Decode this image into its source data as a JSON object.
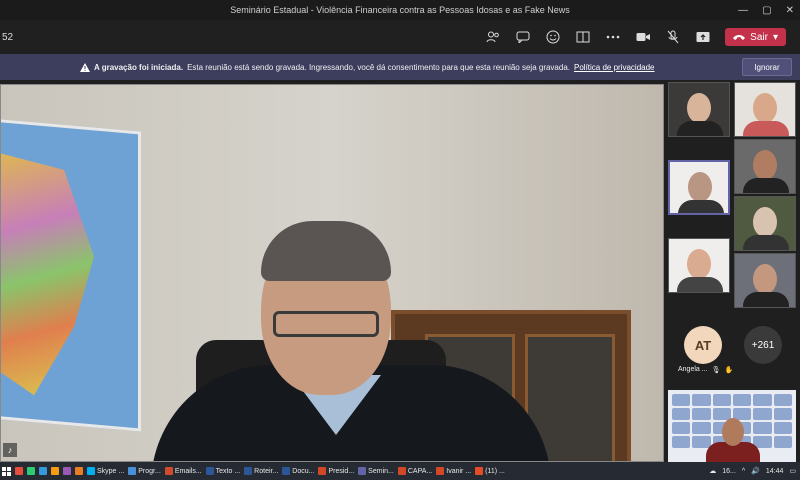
{
  "window": {
    "title": "Seminário Estadual - Violência Financeira contra as Pessoas Idosas e as Fake News",
    "controls": [
      "—",
      "▢",
      "✕"
    ]
  },
  "toolbar": {
    "timer": "52",
    "leave_label": "Sair",
    "tools": [
      "people-icon",
      "chat-icon",
      "react-icon",
      "rooms-icon",
      "more-icon",
      "camera-icon",
      "mic-off-icon",
      "share-icon"
    ]
  },
  "banner": {
    "bold": "A gravação foi iniciada.",
    "text": "Esta reunião está sendo gravada. Ingressando, você dá consentimento para que esta reunião seja gravada.",
    "link": "Política de privacidade",
    "dismiss": "Ignorar"
  },
  "participants": {
    "avatar_initials": "AT",
    "avatar_name": "Angela ...",
    "overflow_count": "+261"
  },
  "taskbar": {
    "items": [
      {
        "label": "",
        "color": "#e74c3c"
      },
      {
        "label": "",
        "color": "#2ecc71"
      },
      {
        "label": "",
        "color": "#3498db"
      },
      {
        "label": "",
        "color": "#f39c12"
      },
      {
        "label": "",
        "color": "#9b59b6"
      },
      {
        "label": "",
        "color": "#e67e22"
      },
      {
        "label": "Skype ...",
        "color": "#00aff0"
      },
      {
        "label": "Progr...",
        "color": "#4a90d9"
      },
      {
        "label": "Emails...",
        "color": "#d04a2f"
      },
      {
        "label": "Texto ...",
        "color": "#2b5797"
      },
      {
        "label": "Roteir...",
        "color": "#2b5797"
      },
      {
        "label": "Docu...",
        "color": "#2b5797"
      },
      {
        "label": "Presid...",
        "color": "#d24726"
      },
      {
        "label": "Semin...",
        "color": "#6264a7"
      },
      {
        "label": "CAPA...",
        "color": "#d24726"
      },
      {
        "label": "Ivanir ...",
        "color": "#d24726"
      },
      {
        "label": "(11) ...",
        "color": "#e34c26"
      }
    ],
    "tray_temp": "16...",
    "clock": "14:44"
  }
}
